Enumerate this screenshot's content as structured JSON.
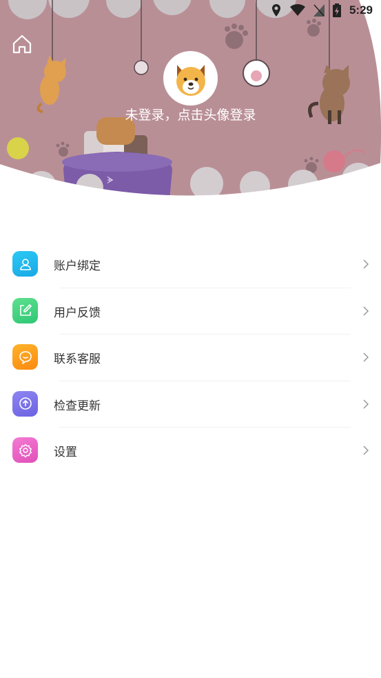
{
  "status_bar": {
    "time": "5:29"
  },
  "header": {
    "login_hint": "未登录，点击头像登录",
    "colors": {
      "background": "#b98f96",
      "wave": "#ffffff",
      "bowl": "#7c5ba8"
    }
  },
  "menu": {
    "items": [
      {
        "label": "账户绑定",
        "icon": "user-icon",
        "color_from": "#2bc9f3",
        "color_to": "#19a8e6"
      },
      {
        "label": "用户反馈",
        "icon": "edit-icon",
        "color_from": "#5fe08e",
        "color_to": "#2ec775"
      },
      {
        "label": "联系客服",
        "icon": "chat-icon",
        "color_from": "#ffb32b",
        "color_to": "#fb8a10"
      },
      {
        "label": "检查更新",
        "icon": "upload-icon",
        "color_from": "#8e86f1",
        "color_to": "#6c62e2"
      },
      {
        "label": "设置",
        "icon": "gear-icon",
        "color_from": "#f47ad3",
        "color_to": "#e051b8"
      }
    ]
  }
}
